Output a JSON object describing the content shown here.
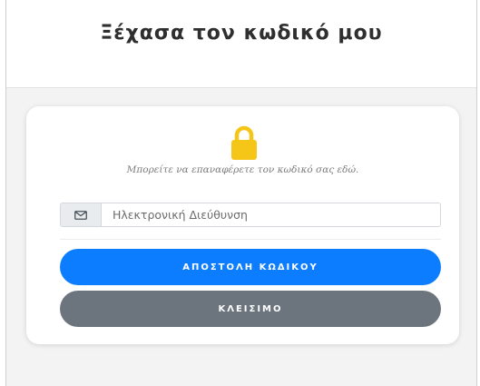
{
  "header": {
    "title": "Ξέχασα τον κωδικό μου"
  },
  "card": {
    "icon": "lock-icon",
    "icon_color": "#f5c518",
    "hint": "Μπορείτε να επαναφέρετε τον κωδικό σας εδώ.",
    "email": {
      "icon": "envelope-icon",
      "placeholder": "Ηλεκτρονική Διεύθυνση",
      "value": ""
    },
    "send_button": {
      "label": "ΑΠΟΣΤΟΛΗ ΚΩΔΙΚΟΥ",
      "color": "#0d7dff"
    },
    "close_button": {
      "label": "ΚΛΕΙΣΙΜΟ",
      "color": "#6c757d"
    }
  }
}
